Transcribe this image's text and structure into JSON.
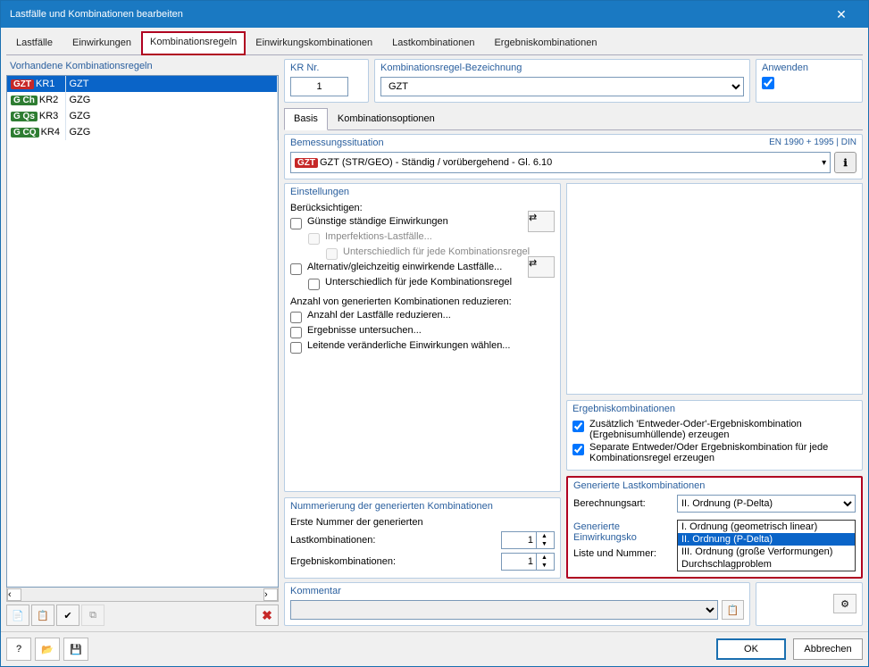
{
  "window": {
    "title": "Lastfälle und Kombinationen bearbeiten"
  },
  "tabs": {
    "t0": "Lastfälle",
    "t1": "Einwirkungen",
    "t2": "Kombinationsregeln",
    "t3": "Einwirkungskombinationen",
    "t4": "Lastkombinationen",
    "t5": "Ergebniskombinationen"
  },
  "left": {
    "title": "Vorhandene Kombinationsregeln",
    "rows": [
      {
        "badge": "GZT",
        "badgeCls": "bGZT",
        "code": "KR1",
        "name": "GZT"
      },
      {
        "badge": "G Ch",
        "badgeCls": "bGCh",
        "code": "KR2",
        "name": "GZG"
      },
      {
        "badge": "G Qs",
        "badgeCls": "bGQs",
        "code": "KR3",
        "name": "GZG"
      },
      {
        "badge": "G CQ",
        "badgeCls": "bGCQ",
        "code": "KR4",
        "name": "GZG"
      }
    ]
  },
  "kr": {
    "nr_label": "KR Nr.",
    "nr_value": "1",
    "bez_label": "Kombinationsregel-Bezeichnung",
    "bez_value": "GZT",
    "anw_label": "Anwenden",
    "anw_checked": true
  },
  "innerTabs": {
    "basis": "Basis",
    "optionen": "Kombinationsoptionen"
  },
  "bemess": {
    "title": "Bemessungssituation",
    "std": "EN 1990 + 1995 | DIN",
    "value": "GZT (STR/GEO) - Ständig / vorübergehend - Gl. 6.10",
    "badge": "GZT"
  },
  "einst": {
    "title": "Einstellungen",
    "beruck": "Berücksichtigen:",
    "c1": "Günstige ständige Einwirkungen",
    "c2": "Imperfektions-Lastfälle...",
    "c3": "Unterschiedlich für jede Kombinationsregel",
    "c4": "Alternativ/gleichzeitig einwirkende Lastfälle...",
    "c5": "Unterschiedlich für jede Kombinationsregel",
    "red": "Anzahl von generierten Kombinationen reduzieren:",
    "c6": "Anzahl der Lastfälle reduzieren...",
    "c7": "Ergebnisse untersuchen...",
    "c8": "Leitende veränderliche Einwirkungen wählen..."
  },
  "numm": {
    "title": "Nummerierung der generierten Kombinationen",
    "line1": "Erste Nummer der generierten",
    "lastkomb": "Lastkombinationen:",
    "lastkomb_val": "1",
    "ergkomb": "Ergebniskombinationen:",
    "ergkomb_val": "1"
  },
  "ergk": {
    "title": "Ergebniskombinationen",
    "c1": "Zusätzlich 'Entweder-Oder'-Ergebniskombination (Ergebnisumhüllende) erzeugen",
    "c2": "Separate Entweder/Oder Ergebniskombination für jede Kombinationsregel  erzeugen"
  },
  "genLK": {
    "title": "Generierte Lastkombinationen",
    "lbl1": "Berechnungsart:",
    "selected": "II. Ordnung (P-Delta)",
    "opt0": "I. Ordnung (geometrisch linear)",
    "opt1": "II. Ordnung (P-Delta)",
    "opt2": "III. Ordnung (große Verformungen)",
    "opt3": "Durchschlagproblem"
  },
  "genEK": {
    "title": "Generierte Einwirkungsko",
    "lbl": "Liste und Nummer:"
  },
  "kommentar": {
    "title": "Kommentar"
  },
  "footer": {
    "ok": "OK",
    "cancel": "Abbrechen"
  }
}
